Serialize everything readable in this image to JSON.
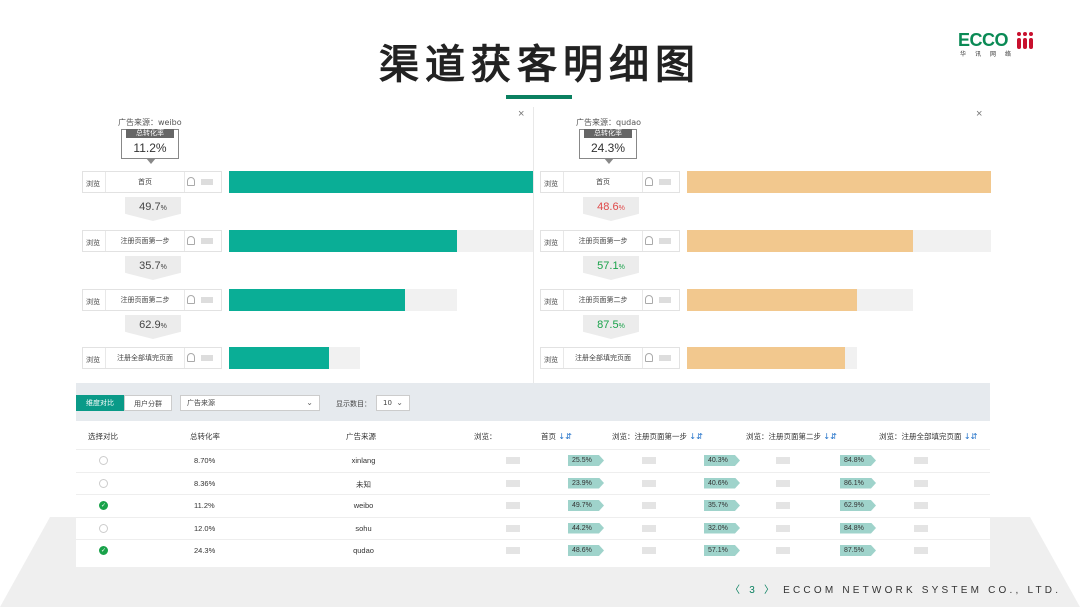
{
  "slide": {
    "title": "渠道获客明细图",
    "logo_text": "ECCO",
    "logo_cn": "华讯网络",
    "footer_prev": "〈",
    "footer_page": "3",
    "footer_next": "〉",
    "footer_company": "ECCOM NETWORK SYSTEM CO., LTD.",
    "accent": "#0a8060"
  },
  "funnels": [
    {
      "source_label": "广告来源：weibo",
      "conv_caption": "总转化率",
      "conv_value": "11.2%",
      "bar_color": "#0aae96",
      "close": "×",
      "steps": [
        {
          "kind": "浏览",
          "page": "首页",
          "fill": 1.0,
          "track": 1.0
        },
        {
          "kind": "浏览",
          "page": "注册页面第一步",
          "fill": 0.749,
          "track": 1.0
        },
        {
          "kind": "浏览",
          "page": "注册页面第二步",
          "fill": 0.58,
          "track": 0.749
        },
        {
          "kind": "浏览",
          "page": "注册全部填完页面",
          "fill": 0.33,
          "track": 0.43
        }
      ],
      "rates": [
        {
          "value": "49.7",
          "unit": "%",
          "color": "#444444"
        },
        {
          "value": "35.7",
          "unit": "%",
          "color": "#444444"
        },
        {
          "value": "62.9",
          "unit": "%",
          "color": "#444444"
        }
      ]
    },
    {
      "source_label": "广告来源：qudao",
      "conv_caption": "总转化率",
      "conv_value": "24.3%",
      "bar_color": "#f2c88e",
      "close": "×",
      "steps": [
        {
          "kind": "浏览",
          "page": "首页",
          "fill": 1.0,
          "track": 1.0
        },
        {
          "kind": "浏览",
          "page": "注册页面第一步",
          "fill": 0.743,
          "track": 1.0
        },
        {
          "kind": "浏览",
          "page": "注册页面第二步",
          "fill": 0.56,
          "track": 0.743
        },
        {
          "kind": "浏览",
          "page": "注册全部填完页面",
          "fill": 0.52,
          "track": 0.56
        }
      ],
      "rates": [
        {
          "value": "48.6",
          "unit": "%",
          "color": "#e04848"
        },
        {
          "value": "57.1",
          "unit": "%",
          "color": "#19a24a"
        },
        {
          "value": "87.5",
          "unit": "%",
          "color": "#19a24a"
        }
      ]
    }
  ],
  "toolbar": {
    "tab_active": "维度对比",
    "tab_plain": "用户分群",
    "source_select": "广告来源",
    "show_label": "显示数目：",
    "show_value": "10",
    "chevron": "⌄"
  },
  "table": {
    "headers": {
      "compare": "选择对比",
      "conv": "总转化率",
      "source": "广告来源",
      "browse": "浏览：",
      "home": "首页",
      "step1": "浏览：注册页面第一步",
      "step2": "浏览：注册页面第二步",
      "step3": "浏览：注册全部填完页面",
      "sort_icon": "↓⇵"
    },
    "rows": [
      {
        "checked": false,
        "conv": "8.70%",
        "source": "xinlang",
        "p1": "25.5%",
        "p2": "40.3%",
        "p3": "84.8%"
      },
      {
        "checked": false,
        "conv": "8.36%",
        "source": "未知",
        "p1": "23.9%",
        "p2": "40.6%",
        "p3": "86.1%"
      },
      {
        "checked": true,
        "conv": "11.2%",
        "source": "weibo",
        "p1": "49.7%",
        "p2": "35.7%",
        "p3": "62.9%"
      },
      {
        "checked": false,
        "conv": "12.0%",
        "source": "sohu",
        "p1": "44.2%",
        "p2": "32.0%",
        "p3": "84.8%"
      },
      {
        "checked": true,
        "conv": "24.3%",
        "source": "qudao",
        "p1": "48.6%",
        "p2": "57.1%",
        "p3": "87.5%"
      }
    ]
  }
}
